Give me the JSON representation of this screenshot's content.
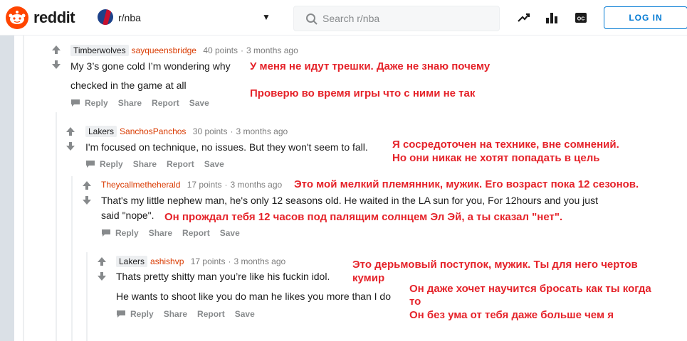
{
  "header": {
    "logo_text": "reddit",
    "subreddit": "r/nba",
    "search_placeholder": "Search r/nba",
    "login_label": "LOG IN",
    "icons": [
      "trending-icon",
      "leaderboard-icon",
      "oc-icon"
    ]
  },
  "comments": [
    {
      "flair": "Timberwolves",
      "author": "sayqueensbridge",
      "points": "40 points",
      "time": "3 months ago",
      "lines": [
        "My 3’s gone cold I’m wondering why",
        "checked in the game at all"
      ],
      "actions": [
        "Reply",
        "Share",
        "Report",
        "Save"
      ]
    },
    {
      "flair": "Lakers",
      "author": "SanchosPanchos",
      "points": "30 points",
      "time": "3 months ago",
      "lines": [
        "I'm focused on technique, no issues. But they won't seem to fall."
      ],
      "actions": [
        "Reply",
        "Share",
        "Report",
        "Save"
      ]
    },
    {
      "flair": "",
      "author": "Theycallmetheherald",
      "points": "17 points",
      "time": "3 months ago",
      "lines": [
        "That's my little nephew man, he's only 12 seasons old. He waited in the LA sun for you, For 12hours and you just",
        "said \"nope\"."
      ],
      "actions": [
        "Reply",
        "Share",
        "Report",
        "Save"
      ]
    },
    {
      "flair": "Lakers",
      "author": "ashishvp",
      "points": "17 points",
      "time": "3 months ago",
      "lines": [
        "Thats pretty shitty man you’re like his fuckin idol.",
        "He wants to shoot like you do man he likes you more than I do"
      ],
      "actions": [
        "Reply",
        "Share",
        "Report",
        "Save"
      ]
    }
  ],
  "translations": {
    "t1a": "У меня не идут трешки. Даже не знаю почему",
    "t1b": "Проверю во время игры что с ними не так",
    "t2a": "Я сосредоточен на технике, вне сомнений.",
    "t2b": "Но они никак не хотят попадать в цель",
    "t3a": "Это мой мелкий племянник, мужик. Его возраст пока 12 сезонов.",
    "t3b": "Он прождал тебя 12 часов под палящим солнцем Эл Эй, а ты сказал \"нет\".",
    "t4a": "Это дерьмовый поступок, мужик. Ты для него чертов",
    "t4b": "кумир",
    "t4c": "Он даже хочет научится бросать как ты когда",
    "t4d": "то",
    "t4e": "Он без ума от тебя даже больше чем я"
  },
  "colors": {
    "brand": "#ff4500",
    "author": "#d93a00",
    "translation": "#e5232a",
    "login": "#0079d3"
  }
}
